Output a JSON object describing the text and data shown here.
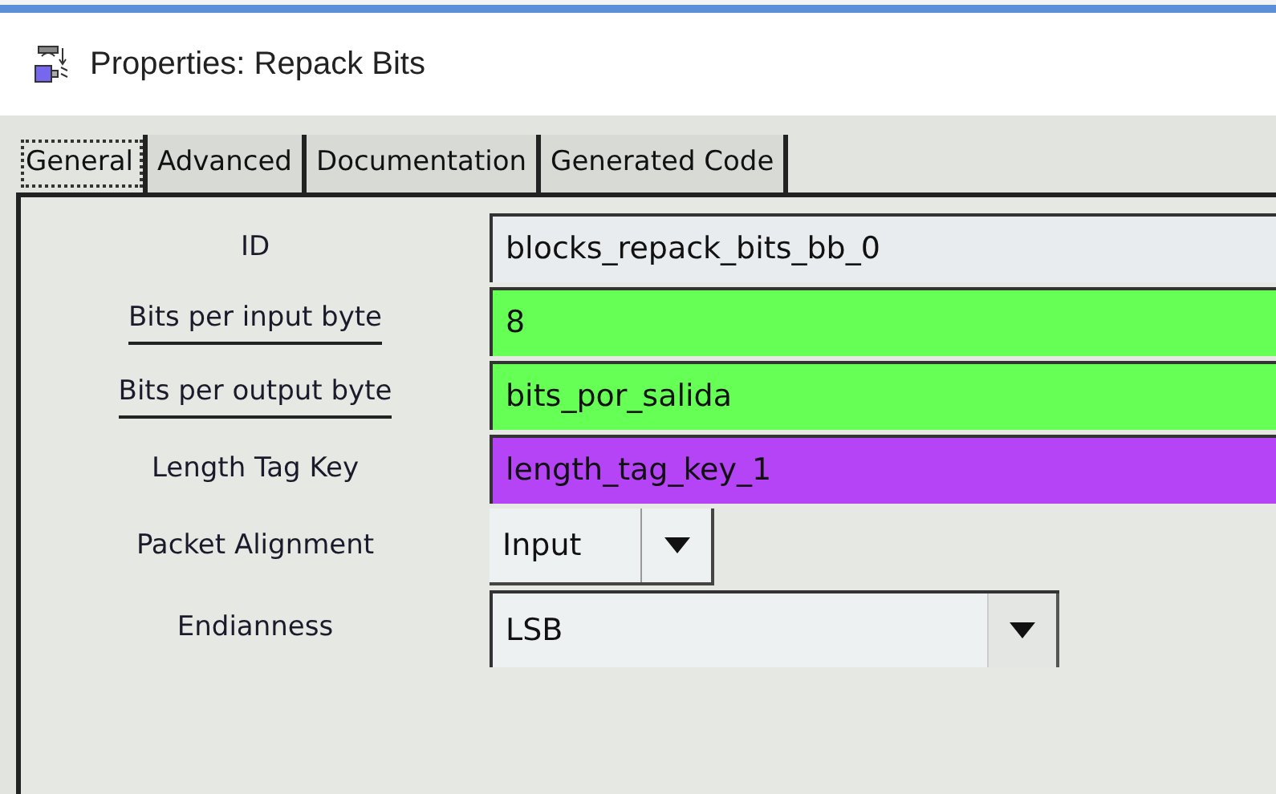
{
  "window": {
    "title": "Properties: Repack Bits"
  },
  "tabs": [
    {
      "label": "General",
      "selected": true
    },
    {
      "label": "Advanced",
      "selected": false
    },
    {
      "label": "Documentation",
      "selected": false
    },
    {
      "label": "Generated Code",
      "selected": false
    }
  ],
  "params": [
    {
      "label": "ID",
      "underlined": false,
      "kind": "text",
      "value": "blocks_repack_bits_bb_0",
      "color": "#e8ecee"
    },
    {
      "label": "Bits per input byte",
      "underlined": true,
      "kind": "text",
      "value": "8",
      "color": "#66ff55"
    },
    {
      "label": "Bits per output byte",
      "underlined": true,
      "kind": "text",
      "value": "bits_por_salida",
      "color": "#66ff55"
    },
    {
      "label": "Length Tag Key",
      "underlined": false,
      "kind": "text",
      "value": "length_tag_key_1",
      "color": "#b444f5"
    },
    {
      "label": "Packet Alignment",
      "underlined": false,
      "kind": "short_combo",
      "value": "Input"
    },
    {
      "label": "Endianness",
      "underlined": false,
      "kind": "wide_combo",
      "value": "LSB"
    }
  ]
}
